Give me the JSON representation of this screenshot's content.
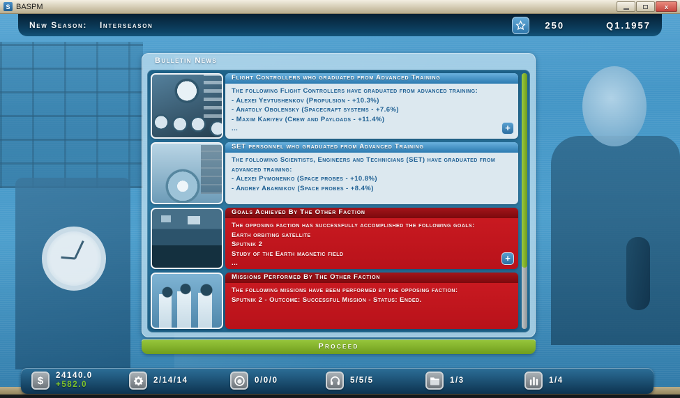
{
  "window": {
    "title": "BASPM"
  },
  "header": {
    "new_season_label": "New Season:",
    "season_value": "Interseason",
    "star_count": "250",
    "date": "Q1.1957"
  },
  "bulletin": {
    "title": "Bulletin News",
    "proceed_label": "Proceed",
    "items": [
      {
        "tone": "blue",
        "title": "Flight Controllers who graduated from Advanced Training",
        "lines": [
          "The following Flight Controllers have graduated from advanced training:",
          "- Alexei Yevtushenkov (Propulsion - +10.3%)",
          "- Anatoly Obolensky (Spacecraft systems - +7.6%)",
          "- Maxim Kariyev (Crew and Payloads - +11.4%)",
          "..."
        ],
        "expand_label": "+"
      },
      {
        "tone": "blue",
        "title": "SET personnel who graduated from Advanced Training",
        "lines": [
          "The following Scientists, Engineers and Technicians (SET) have graduated from advanced training:",
          "- Alexei Pymonenko (Space probes - +10.8%)",
          "- Andrey Abarnikov (Space probes - +8.4%)"
        ]
      },
      {
        "tone": "red",
        "title": "Goals Achieved By The Other Faction",
        "lines": [
          "The opposing faction has successfully accomplished the following goals:",
          "Earth orbiting satellite",
          "Sputnik 2",
          "Study of the Earth magnetic field",
          "..."
        ],
        "expand_label": "+"
      },
      {
        "tone": "red",
        "title": "Missions Performed By The Other Faction",
        "lines": [
          "The following missions have been performed by the opposing faction:",
          "Sputnik 2 - Outcome: Successful Mission - Status: Ended."
        ]
      }
    ]
  },
  "status_bar": {
    "funds": {
      "icon": "dollar-icon",
      "value": "24140.0",
      "delta": "+582.0"
    },
    "stats": [
      {
        "icon": "gear-icon",
        "value": "2/14/14"
      },
      {
        "icon": "astronaut-helmet-icon",
        "value": "0/0/0"
      },
      {
        "icon": "headset-icon",
        "value": "5/5/5"
      },
      {
        "icon": "folder-icon",
        "value": "1/3"
      },
      {
        "icon": "rockets-icon",
        "value": "1/4"
      }
    ]
  },
  "colors": {
    "accent_blue": "#3d86c0",
    "alert_red": "#c9171e",
    "proceed_green": "#7fb22a",
    "delta_green": "#7ec32c",
    "panel_teal": "#26719a"
  }
}
